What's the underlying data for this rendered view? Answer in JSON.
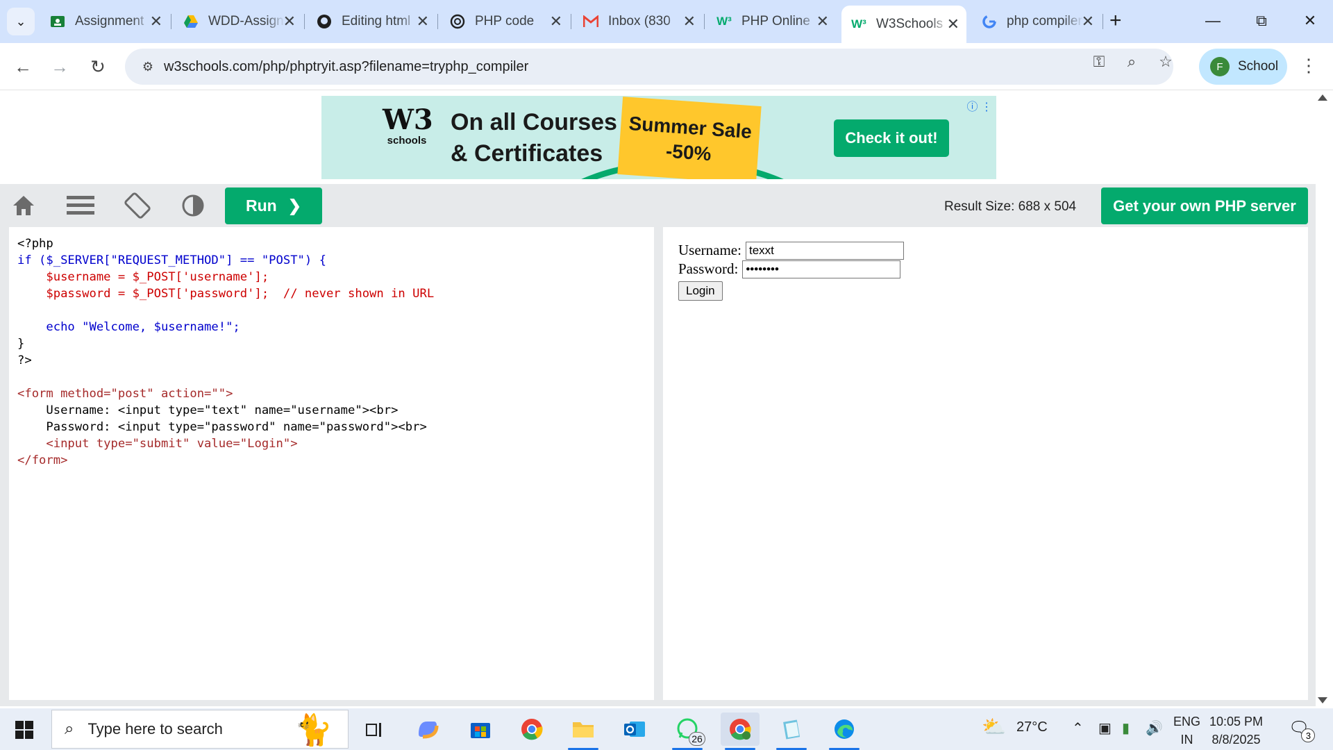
{
  "browser": {
    "tabs": [
      {
        "label": "Assignment",
        "favicon": "classroom-icon",
        "color": "#188038"
      },
      {
        "label": "WDD-Assignment",
        "favicon": "drive-icon",
        "color": "#fbbc04"
      },
      {
        "label": "Editing html",
        "favicon": "github-icon",
        "color": "#1f1f1f"
      },
      {
        "label": "PHP code",
        "favicon": "chatgpt-icon",
        "color": "#1f1f1f"
      },
      {
        "label": "Inbox (830",
        "favicon": "gmail-icon",
        "color": "#ea4335"
      },
      {
        "label": "PHP Online",
        "favicon": "w3schools-icon",
        "color": "#04aa6d"
      },
      {
        "label": "W3Schools",
        "favicon": "w3schools-icon",
        "color": "#04aa6d",
        "active": true
      },
      {
        "label": "php compiler",
        "favicon": "google-icon",
        "color": "#4285f4"
      }
    ],
    "url": "w3schools.com/php/phptryit.asp?filename=tryphp_compiler",
    "profile": {
      "initial": "F",
      "label": "School"
    }
  },
  "ad": {
    "logo_mark": "W3",
    "logo_text": "schools",
    "headline_line1": "On all Courses",
    "headline_line2": "& Certificates",
    "sale_line1": "Summer Sale",
    "sale_line2": "-50%",
    "cta": "Check it out!"
  },
  "tryit_toolbar": {
    "run_label": "Run",
    "result_size": "Result Size: 688 x 504",
    "server_button": "Get your own PHP server"
  },
  "result_form": {
    "username_label": "Username:",
    "username_value": "texxt",
    "password_label": "Password:",
    "password_value": "••••••••",
    "submit_label": "Login"
  },
  "code_lines": [
    "<?php",
    "if ($_SERVER[\"REQUEST_METHOD\"] == \"POST\") {",
    "    $username = $_POST['username'];",
    "    $password = $_POST['password'];  // never shown in URL",
    "",
    "    echo \"Welcome, $username!\";",
    "}",
    "?>",
    "",
    "<form method=\"post\" action=\"\">",
    "    Username: <input type=\"text\" name=\"username\"><br>",
    "    Password: <input type=\"password\" name=\"password\"><br>",
    "    <input type=\"submit\" value=\"Login\">",
    "</form>"
  ],
  "taskbar": {
    "search_placeholder": "Type here to search",
    "weather": "27°C",
    "lang_line1": "ENG",
    "lang_line2": "IN",
    "time": "10:05 PM",
    "date": "8/8/2025",
    "whatsapp_badge": "26",
    "notification_count": "3"
  },
  "colors": {
    "accent": "#04aa6d",
    "tabstrip": "#d3e3fd"
  }
}
